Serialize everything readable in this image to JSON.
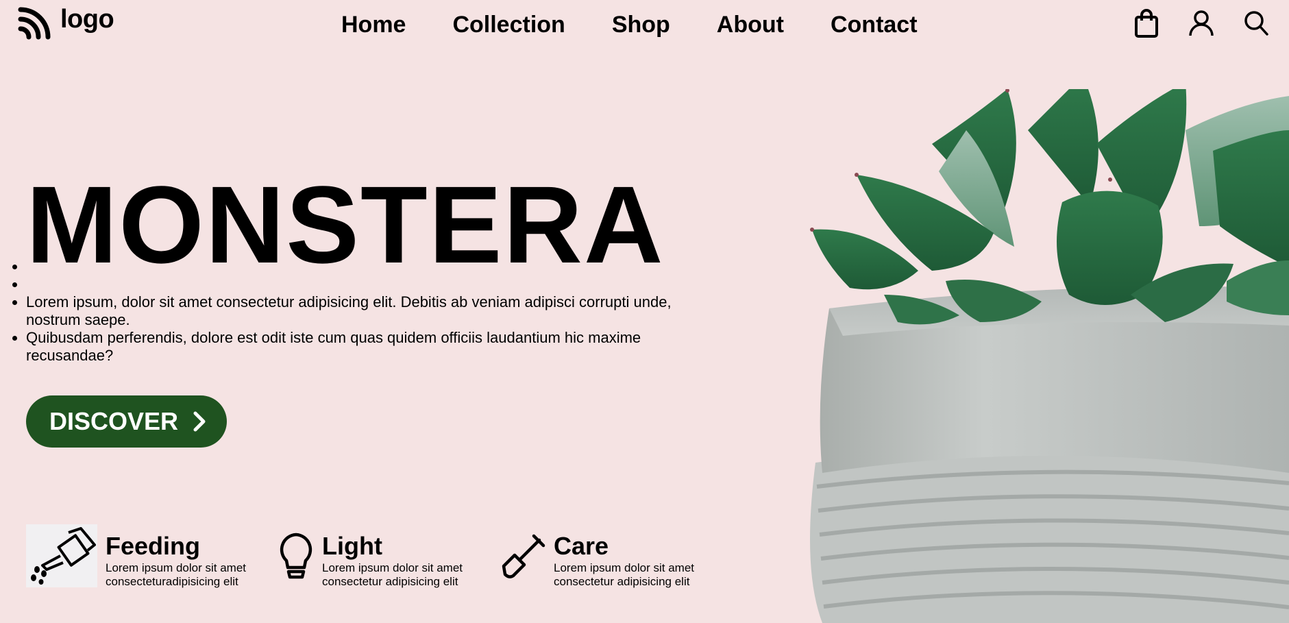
{
  "header": {
    "logo_text": "logo",
    "nav": [
      "Home",
      "Collection",
      "Shop",
      "About",
      "Contact"
    ],
    "icons": [
      "shopping-bag-icon",
      "user-icon",
      "search-icon"
    ]
  },
  "hero": {
    "title": "MONSTERA",
    "bullets": [
      "",
      "",
      "Lorem ipsum, dolor sit amet consectetur adipisicing elit. Debitis ab veniam adipisci corrupti unde, nostrum saepe.",
      "Quibusdam perferendis, dolore est odit iste cum quas quidem officiis laudantium hic maxime recusandae?"
    ],
    "button_label": "DISCOVER"
  },
  "features": [
    {
      "title": "Feeding",
      "desc": "Lorem ipsum dolor sit amet consecteturadipisicing elit",
      "icon": "watering-can-icon"
    },
    {
      "title": "Light",
      "desc": "Lorem ipsum dolor sit amet consectetur adipisicing elit",
      "icon": "light-bulb-icon"
    },
    {
      "title": "Care",
      "desc": "Lorem ipsum dolor sit amet consectetur adipisicing elit",
      "icon": "shovel-icon"
    }
  ],
  "colors": {
    "background": "#f5e3e3",
    "button": "#1f5320",
    "button_text": "#ffffff",
    "text": "#000000"
  }
}
